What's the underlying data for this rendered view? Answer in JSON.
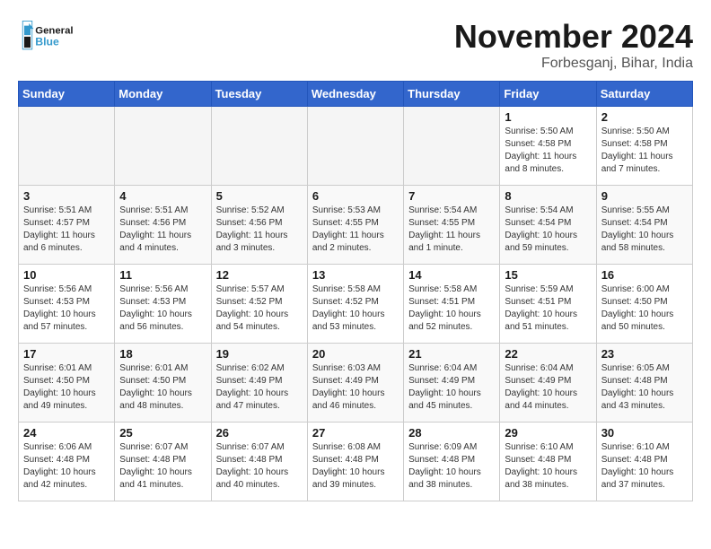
{
  "header": {
    "logo_text_general": "General",
    "logo_text_blue": "Blue",
    "month_title": "November 2024",
    "location": "Forbesganj, Bihar, India"
  },
  "calendar": {
    "days_of_week": [
      "Sunday",
      "Monday",
      "Tuesday",
      "Wednesday",
      "Thursday",
      "Friday",
      "Saturday"
    ],
    "weeks": [
      [
        {
          "day": "",
          "content": ""
        },
        {
          "day": "",
          "content": ""
        },
        {
          "day": "",
          "content": ""
        },
        {
          "day": "",
          "content": ""
        },
        {
          "day": "",
          "content": ""
        },
        {
          "day": "1",
          "content": "Sunrise: 5:50 AM\nSunset: 4:58 PM\nDaylight: 11 hours and 8 minutes."
        },
        {
          "day": "2",
          "content": "Sunrise: 5:50 AM\nSunset: 4:58 PM\nDaylight: 11 hours and 7 minutes."
        }
      ],
      [
        {
          "day": "3",
          "content": "Sunrise: 5:51 AM\nSunset: 4:57 PM\nDaylight: 11 hours and 6 minutes."
        },
        {
          "day": "4",
          "content": "Sunrise: 5:51 AM\nSunset: 4:56 PM\nDaylight: 11 hours and 4 minutes."
        },
        {
          "day": "5",
          "content": "Sunrise: 5:52 AM\nSunset: 4:56 PM\nDaylight: 11 hours and 3 minutes."
        },
        {
          "day": "6",
          "content": "Sunrise: 5:53 AM\nSunset: 4:55 PM\nDaylight: 11 hours and 2 minutes."
        },
        {
          "day": "7",
          "content": "Sunrise: 5:54 AM\nSunset: 4:55 PM\nDaylight: 11 hours and 1 minute."
        },
        {
          "day": "8",
          "content": "Sunrise: 5:54 AM\nSunset: 4:54 PM\nDaylight: 10 hours and 59 minutes."
        },
        {
          "day": "9",
          "content": "Sunrise: 5:55 AM\nSunset: 4:54 PM\nDaylight: 10 hours and 58 minutes."
        }
      ],
      [
        {
          "day": "10",
          "content": "Sunrise: 5:56 AM\nSunset: 4:53 PM\nDaylight: 10 hours and 57 minutes."
        },
        {
          "day": "11",
          "content": "Sunrise: 5:56 AM\nSunset: 4:53 PM\nDaylight: 10 hours and 56 minutes."
        },
        {
          "day": "12",
          "content": "Sunrise: 5:57 AM\nSunset: 4:52 PM\nDaylight: 10 hours and 54 minutes."
        },
        {
          "day": "13",
          "content": "Sunrise: 5:58 AM\nSunset: 4:52 PM\nDaylight: 10 hours and 53 minutes."
        },
        {
          "day": "14",
          "content": "Sunrise: 5:58 AM\nSunset: 4:51 PM\nDaylight: 10 hours and 52 minutes."
        },
        {
          "day": "15",
          "content": "Sunrise: 5:59 AM\nSunset: 4:51 PM\nDaylight: 10 hours and 51 minutes."
        },
        {
          "day": "16",
          "content": "Sunrise: 6:00 AM\nSunset: 4:50 PM\nDaylight: 10 hours and 50 minutes."
        }
      ],
      [
        {
          "day": "17",
          "content": "Sunrise: 6:01 AM\nSunset: 4:50 PM\nDaylight: 10 hours and 49 minutes."
        },
        {
          "day": "18",
          "content": "Sunrise: 6:01 AM\nSunset: 4:50 PM\nDaylight: 10 hours and 48 minutes."
        },
        {
          "day": "19",
          "content": "Sunrise: 6:02 AM\nSunset: 4:49 PM\nDaylight: 10 hours and 47 minutes."
        },
        {
          "day": "20",
          "content": "Sunrise: 6:03 AM\nSunset: 4:49 PM\nDaylight: 10 hours and 46 minutes."
        },
        {
          "day": "21",
          "content": "Sunrise: 6:04 AM\nSunset: 4:49 PM\nDaylight: 10 hours and 45 minutes."
        },
        {
          "day": "22",
          "content": "Sunrise: 6:04 AM\nSunset: 4:49 PM\nDaylight: 10 hours and 44 minutes."
        },
        {
          "day": "23",
          "content": "Sunrise: 6:05 AM\nSunset: 4:48 PM\nDaylight: 10 hours and 43 minutes."
        }
      ],
      [
        {
          "day": "24",
          "content": "Sunrise: 6:06 AM\nSunset: 4:48 PM\nDaylight: 10 hours and 42 minutes."
        },
        {
          "day": "25",
          "content": "Sunrise: 6:07 AM\nSunset: 4:48 PM\nDaylight: 10 hours and 41 minutes."
        },
        {
          "day": "26",
          "content": "Sunrise: 6:07 AM\nSunset: 4:48 PM\nDaylight: 10 hours and 40 minutes."
        },
        {
          "day": "27",
          "content": "Sunrise: 6:08 AM\nSunset: 4:48 PM\nDaylight: 10 hours and 39 minutes."
        },
        {
          "day": "28",
          "content": "Sunrise: 6:09 AM\nSunset: 4:48 PM\nDaylight: 10 hours and 38 minutes."
        },
        {
          "day": "29",
          "content": "Sunrise: 6:10 AM\nSunset: 4:48 PM\nDaylight: 10 hours and 38 minutes."
        },
        {
          "day": "30",
          "content": "Sunrise: 6:10 AM\nSunset: 4:48 PM\nDaylight: 10 hours and 37 minutes."
        }
      ]
    ]
  }
}
